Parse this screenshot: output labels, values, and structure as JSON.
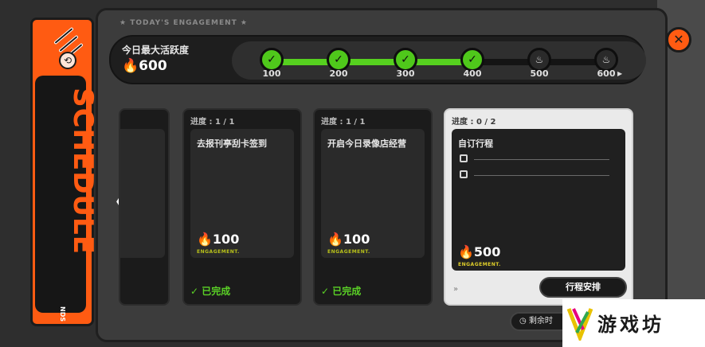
{
  "sidebar": {
    "title": "SCHEDULE",
    "subtitle": "NDS",
    "badge_glyph": "⟲"
  },
  "header": {
    "section_label": "★ TODAY'S ENGAGEMENT ★",
    "max_label": "今日最大活跃度",
    "max_value": "600"
  },
  "progress": {
    "current": 400,
    "milestones": [
      {
        "label": "100",
        "done": true
      },
      {
        "label": "200",
        "done": true
      },
      {
        "label": "300",
        "done": true
      },
      {
        "label": "400",
        "done": true
      },
      {
        "label": "500",
        "done": false
      },
      {
        "label": "600",
        "done": false
      }
    ]
  },
  "cards": [
    {
      "caption": "进度 : 1 / 1",
      "title": "去报刊亭刮卡签到",
      "points": "100",
      "points_sub": "ENGAGEMENT.",
      "status": "已完成"
    },
    {
      "caption": "进度 : 1 / 1",
      "title": "开启今日录像店经营",
      "points": "100",
      "points_sub": "ENGAGEMENT.",
      "status": "已完成"
    },
    {
      "caption": "进度 : 0 / 2",
      "title": "自订行程",
      "points": "500",
      "points_sub": "ENGAGEMENT.",
      "button": "行程安排"
    }
  ],
  "close_glyph": "✕",
  "remaining_label": "剩余时",
  "watermark": {
    "text": "游戏坊"
  },
  "colors": {
    "accent": "#ff5b12",
    "progress": "#56d11f",
    "done": "#5ad026"
  }
}
